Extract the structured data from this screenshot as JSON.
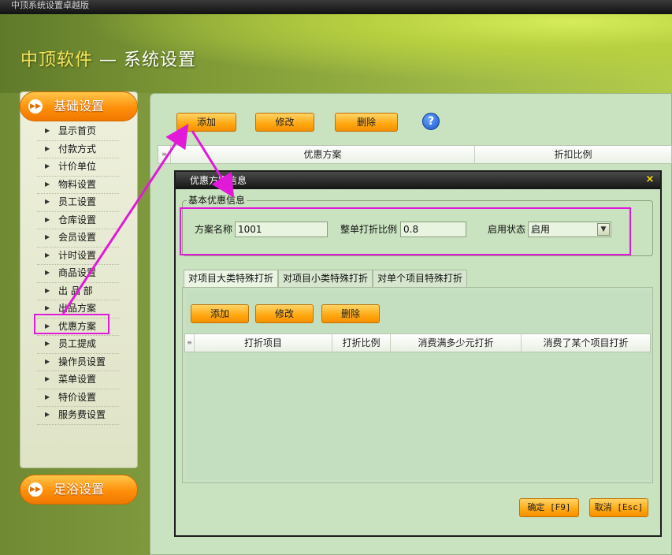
{
  "window": {
    "title": "中顶系统设置卓越版"
  },
  "app": {
    "brand": "中顶软件",
    "separator": " — ",
    "section": "系统设置"
  },
  "nav": {
    "group_top": "基础设置",
    "group_bottom": "足浴设置",
    "items": [
      "显示首页",
      "付款方式",
      "计价单位",
      "物料设置",
      "员工设置",
      "仓库设置",
      "会员设置",
      "计时设置",
      "商品设置",
      "出 品 部",
      "出品方案",
      "优惠方案",
      "员工提成",
      "操作员设置",
      "菜单设置",
      "特价设置",
      "服务费设置"
    ],
    "selected": "优惠方案"
  },
  "toolbar": {
    "add": "添加",
    "edit": "修改",
    "delete": "删除",
    "help": "?"
  },
  "main_grid": {
    "row_marker": "≡",
    "columns": [
      "优惠方案",
      "折扣比例"
    ]
  },
  "dialog": {
    "title": "优惠方案信息",
    "close": "×",
    "group_label": "基本优惠信息",
    "name_label": "方案名称",
    "name_value": "1001",
    "ratio_label": "整单打折比例",
    "ratio_value": "0.8",
    "status_label": "启用状态",
    "status_value": "启用",
    "tabs": [
      "对项目大类特殊打折",
      "对项目小类特殊打折",
      "对单个项目特殊打折"
    ],
    "active_tab": 0,
    "sub_toolbar": {
      "add": "添加",
      "edit": "修改",
      "delete": "删除"
    },
    "sub_grid": {
      "row_marker": "≡",
      "columns": [
        "打折项目",
        "打折比例",
        "消费满多少元打折",
        "消费了某个项目打折"
      ]
    },
    "ok": "确定 [F9]",
    "cancel": "取消 [Esc]"
  },
  "colors": {
    "accent_orange": "#ff9a0a",
    "annotation_magenta": "#e01ad8",
    "panel_green": "#c9e2bf"
  }
}
